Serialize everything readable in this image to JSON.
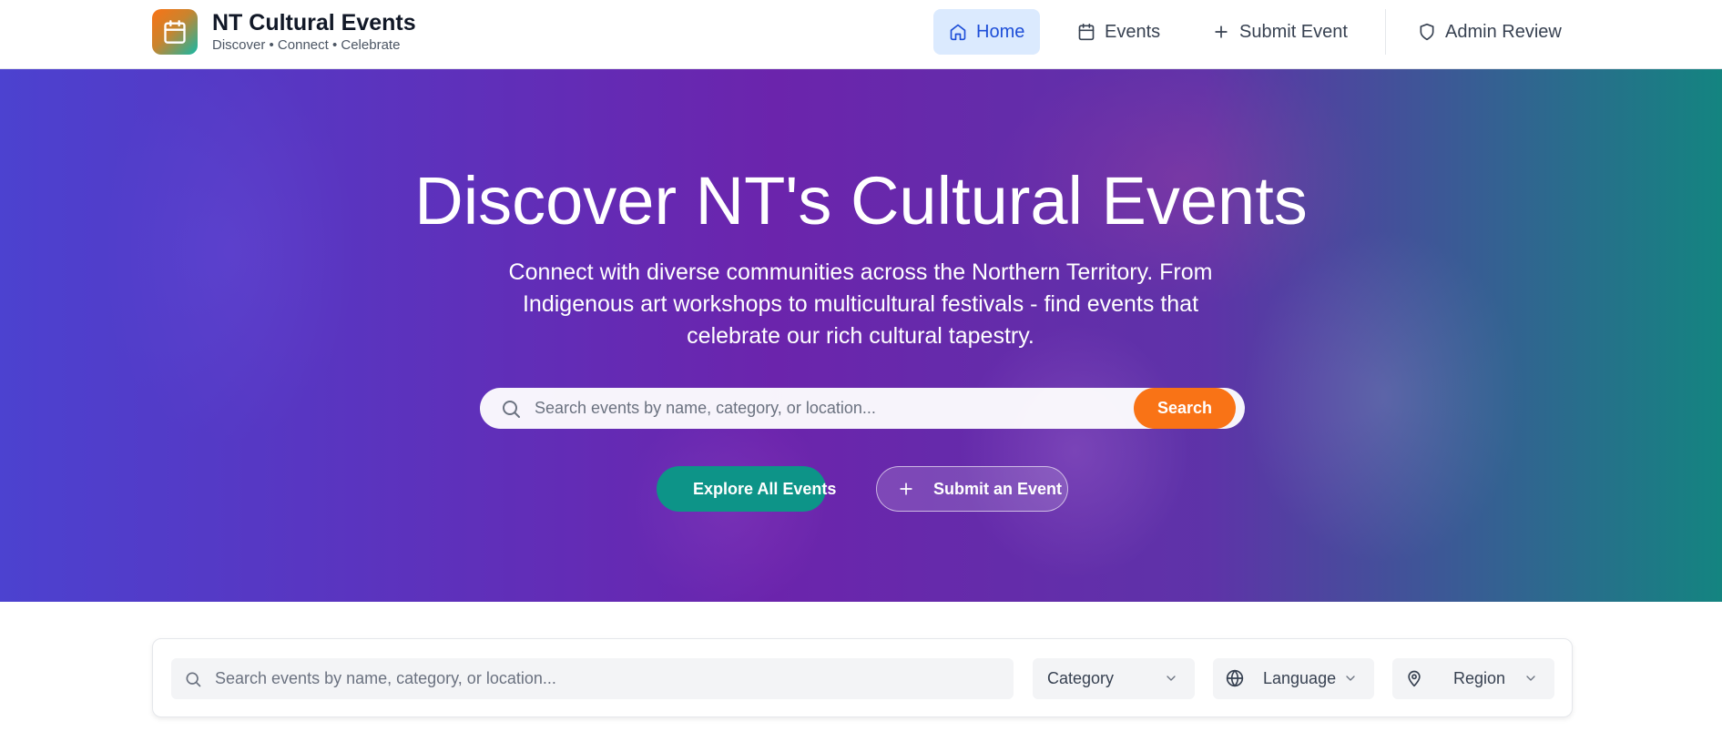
{
  "brand": {
    "title": "NT Cultural Events",
    "tagline": "Discover • Connect • Celebrate",
    "logo_icon": "calendar-icon"
  },
  "nav": {
    "items": [
      {
        "label": "Home",
        "icon": "home-icon",
        "active": true
      },
      {
        "label": "Events",
        "icon": "calendar-icon",
        "active": false
      },
      {
        "label": "Submit Event",
        "icon": "plus-icon",
        "active": false
      },
      {
        "label": "Admin Review",
        "icon": "shield-icon",
        "active": false
      }
    ]
  },
  "hero": {
    "title": "Discover NT's Cultural Events",
    "description": "Connect with diverse communities across the Northern Territory. From Indigenous art workshops to multicultural festivals - find events that celebrate our rich cultural tapestry.",
    "search": {
      "placeholder": "Search events by name, category, or location...",
      "button_label": "Search"
    },
    "explore_label": "Explore All Events",
    "submit_label": "Submit an Event"
  },
  "filters": {
    "search_placeholder": "Search events by name, category, or location...",
    "category_label": "Category",
    "language_label": "Language",
    "region_label": "Region"
  },
  "colors": {
    "accent_orange": "#f97316",
    "accent_teal": "#0d9488",
    "nav_active_bg": "#dbeafe",
    "nav_active_text": "#1d4ed8"
  }
}
